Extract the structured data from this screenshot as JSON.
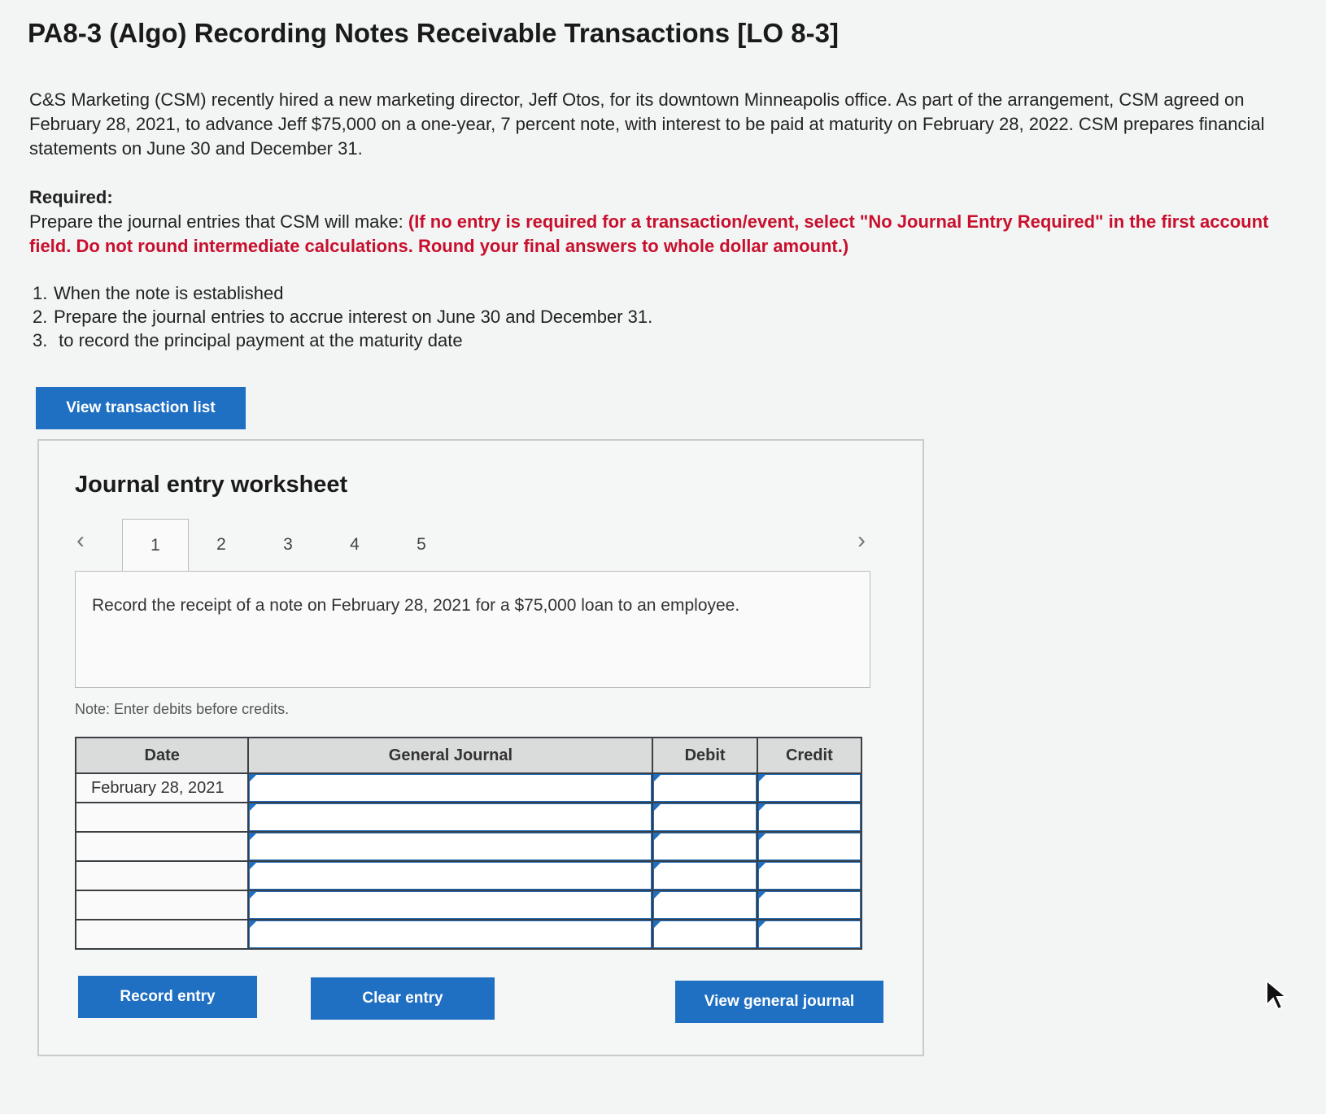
{
  "title": "PA8-3 (Algo) Recording Notes Receivable Transactions [LO 8-3]",
  "intro": "C&S Marketing (CSM) recently hired a new marketing director, Jeff Otos, for its downtown Minneapolis office. As part of the arrangement, CSM agreed on February 28, 2021, to advance Jeff $75,000 on a one-year, 7 percent note, with interest to be paid at maturity on February 28, 2022. CSM prepares financial statements on June 30 and December 31.",
  "required": {
    "heading": "Required:",
    "text": "Prepare the journal entries that CSM will make: ",
    "instruction": "(If no entry is required for a transaction/event, select \"No Journal Entry Required\" in the first account field. Do not round intermediate calculations. Round your final answers to whole dollar amount.)"
  },
  "steps": [
    {
      "num": "1.",
      "text": "When the note is established"
    },
    {
      "num": "2.",
      "text": "Prepare the journal entries to accrue interest on June 30 and December 31."
    },
    {
      "num": "3.",
      "text": " to record the principal payment at the maturity date"
    }
  ],
  "view_transaction_btn": "View transaction list",
  "worksheet": {
    "title": "Journal entry worksheet",
    "tabs": [
      "1",
      "2",
      "3",
      "4",
      "5"
    ],
    "active_tab": "1",
    "description": "Record the receipt of a note on February 28, 2021 for a $75,000 loan to an employee.",
    "note": "Note: Enter debits before credits.",
    "columns": [
      "Date",
      "General Journal",
      "Debit",
      "Credit"
    ],
    "rows": [
      {
        "date": "February 28, 2021"
      },
      {
        "date": ""
      },
      {
        "date": ""
      },
      {
        "date": ""
      },
      {
        "date": ""
      },
      {
        "date": ""
      }
    ],
    "buttons": {
      "record": "Record entry",
      "clear": "Clear entry",
      "view_journal": "View general journal"
    }
  }
}
